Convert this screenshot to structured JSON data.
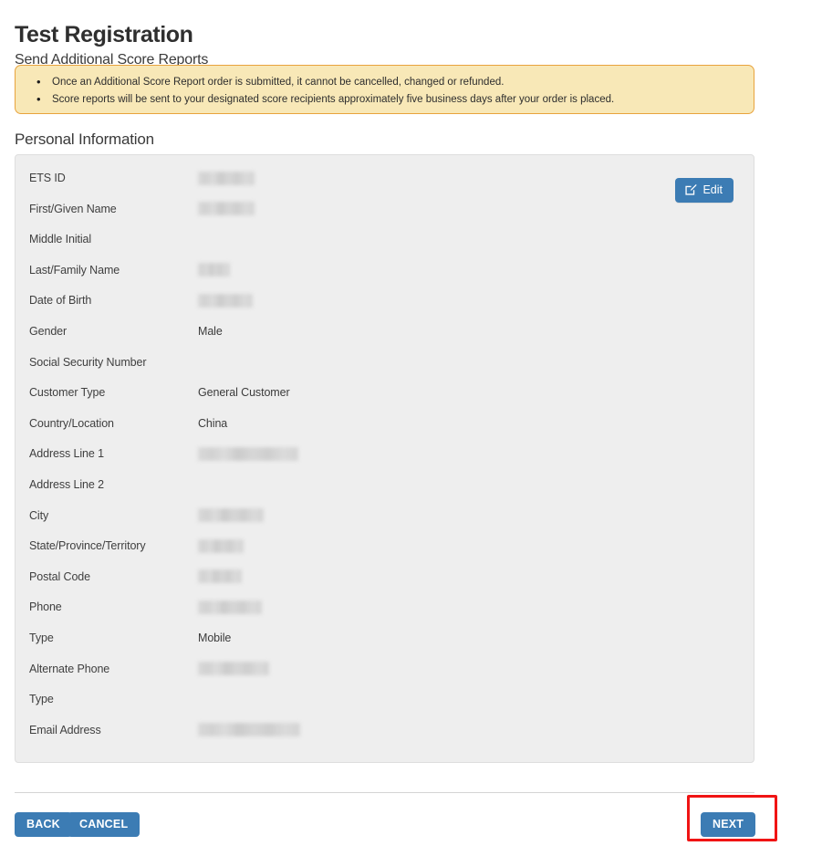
{
  "header": {
    "title": "Test Registration",
    "subtitle": "Send Additional Score Reports"
  },
  "alert": {
    "items": [
      "Once an Additional Score Report order is submitted, it cannot be cancelled, changed or refunded.",
      "Score reports will be sent to your designated score recipients approximately five business days after your order is placed."
    ]
  },
  "section": {
    "heading": "Personal Information",
    "edit_label": "Edit",
    "edit_icon": "edit-square-pencil-icon"
  },
  "fields": [
    {
      "label": "ETS ID",
      "value": "",
      "redacted": true,
      "redact_width": 62
    },
    {
      "label": "First/Given Name",
      "value": "",
      "redacted": true,
      "redact_width": 62
    },
    {
      "label": "Middle Initial",
      "value": "",
      "redacted": false,
      "redact_width": 0
    },
    {
      "label": "Last/Family Name",
      "value": "",
      "redacted": true,
      "redact_width": 35
    },
    {
      "label": "Date of Birth",
      "value": "",
      "redacted": true,
      "redact_width": 60
    },
    {
      "label": "Gender",
      "value": "Male",
      "redacted": false,
      "redact_width": 0
    },
    {
      "label": "Social Security Number",
      "value": "",
      "redacted": false,
      "redact_width": 0
    },
    {
      "label": "Customer Type",
      "value": "General Customer",
      "redacted": false,
      "redact_width": 0
    },
    {
      "label": "Country/Location",
      "value": "China",
      "redacted": false,
      "redact_width": 0
    },
    {
      "label": "Address Line 1",
      "value": "",
      "redacted": true,
      "redact_width": 110
    },
    {
      "label": "Address Line 2",
      "value": "",
      "redacted": false,
      "redact_width": 0
    },
    {
      "label": "City",
      "value": "",
      "redacted": true,
      "redact_width": 72
    },
    {
      "label": "State/Province/Territory",
      "value": "",
      "redacted": true,
      "redact_width": 50
    },
    {
      "label": "Postal Code",
      "value": "",
      "redacted": true,
      "redact_width": 48
    },
    {
      "label": "Phone",
      "value": "",
      "redacted": true,
      "redact_width": 70
    },
    {
      "label": "Type",
      "value": "Mobile",
      "redacted": false,
      "redact_width": 0
    },
    {
      "label": "Alternate Phone",
      "value": "",
      "redacted": true,
      "redact_width": 78
    },
    {
      "label": "Type",
      "value": "",
      "redacted": false,
      "redact_width": 0
    },
    {
      "label": "Email Address",
      "value": "",
      "redacted": true,
      "redact_width": 112
    }
  ],
  "footer": {
    "back_label": "BACK",
    "cancel_label": "CANCEL",
    "next_label": "NEXT"
  },
  "colors": {
    "button_blue": "#3c7cb4",
    "alert_background": "#f8e8b7",
    "alert_border": "#e8a33d",
    "panel_background": "#eeeeee",
    "panel_border": "#dedede",
    "highlight_red": "#f01414",
    "text": "#3f3f3f"
  }
}
